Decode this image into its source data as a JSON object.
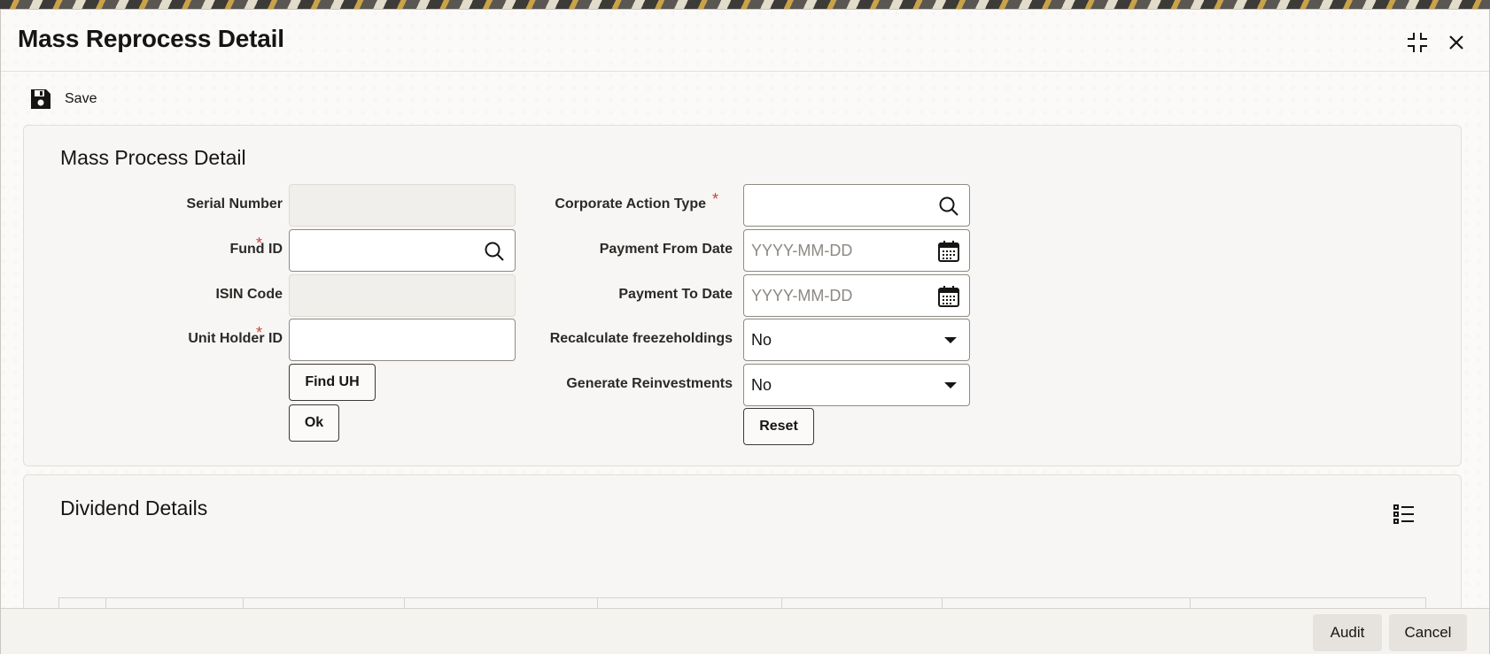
{
  "window": {
    "title": "Mass Reprocess Detail"
  },
  "toolbar": {
    "save_label": "Save",
    "save_icon": "floppy-disk-icon"
  },
  "mass_process": {
    "title": "Mass Process Detail",
    "serial_number": {
      "label": "Serial Number",
      "value": ""
    },
    "fund_id": {
      "label": "Fund ID",
      "required": "*",
      "value": ""
    },
    "isin_code": {
      "label": "ISIN Code",
      "value": ""
    },
    "unit_holder_id": {
      "label": "Unit Holder ID",
      "required": "*",
      "value": ""
    },
    "find_uh_label": "Find UH",
    "ok_label": "Ok",
    "corporate_action_type": {
      "label": "Corporate Action Type",
      "required": "*",
      "value": ""
    },
    "payment_from_date": {
      "label": "Payment From Date",
      "placeholder": "YYYY-MM-DD"
    },
    "payment_to_date": {
      "label": "Payment To Date",
      "placeholder": "YYYY-MM-DD"
    },
    "recalculate_freezeholdings": {
      "label": "Recalculate freezeholdings",
      "value": "No"
    },
    "generate_reinvestments": {
      "label": "Generate Reinvestments",
      "value": "No"
    },
    "reset_label": "Reset"
  },
  "dividend_details": {
    "title": "Dividend Details",
    "list_icon": "list-view-icon"
  },
  "footer": {
    "audit_label": "Audit",
    "cancel_label": "Cancel"
  },
  "colors": {
    "required": "#c74634",
    "panel_bg": "#f7f6f4",
    "border": "#8f8b84"
  }
}
